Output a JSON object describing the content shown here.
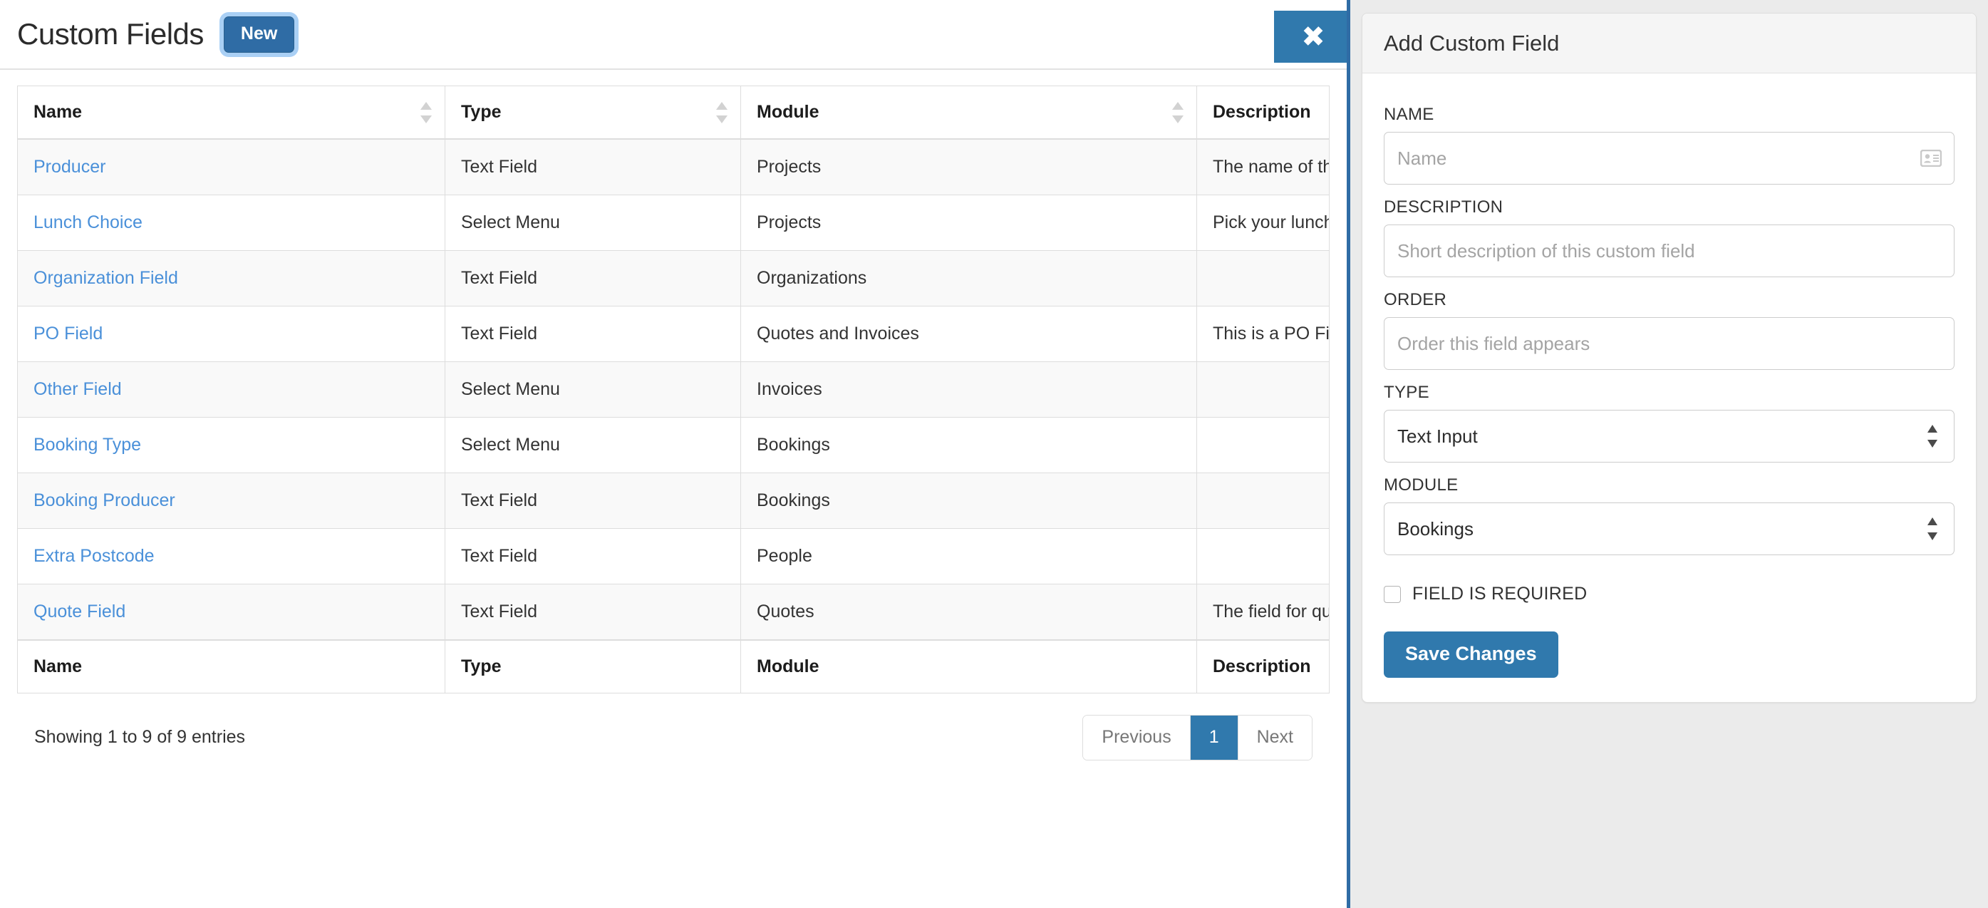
{
  "page": {
    "title": "Custom Fields",
    "new_button_label": "New",
    "close_icon": "close-icon",
    "close_label": "✖"
  },
  "table": {
    "columns": [
      {
        "label": "Name",
        "sortable": true
      },
      {
        "label": "Type",
        "sortable": true
      },
      {
        "label": "Module",
        "sortable": true
      },
      {
        "label": "Description",
        "sortable": true
      }
    ],
    "rows": [
      {
        "name": "Producer",
        "type": "Text Field",
        "module": "Projects",
        "description": "The name of the p"
      },
      {
        "name": "Lunch Choice",
        "type": "Select Menu",
        "module": "Projects",
        "description": "Pick your lunch ch"
      },
      {
        "name": "Organization Field",
        "type": "Text Field",
        "module": "Organizations",
        "description": ""
      },
      {
        "name": "PO Field",
        "type": "Text Field",
        "module": "Quotes and Invoices",
        "description": "This is a PO Field"
      },
      {
        "name": "Other Field",
        "type": "Select Menu",
        "module": "Invoices",
        "description": ""
      },
      {
        "name": "Booking Type",
        "type": "Select Menu",
        "module": "Bookings",
        "description": ""
      },
      {
        "name": "Booking Producer",
        "type": "Text Field",
        "module": "Bookings",
        "description": ""
      },
      {
        "name": "Extra Postcode",
        "type": "Text Field",
        "module": "People",
        "description": ""
      },
      {
        "name": "Quote Field",
        "type": "Text Field",
        "module": "Quotes",
        "description": "The field for quote"
      }
    ],
    "footer_columns": [
      "Name",
      "Type",
      "Module",
      "Description"
    ],
    "entries_info": "Showing 1 to 9 of 9 entries",
    "pagination": {
      "previous_label": "Previous",
      "page_label": "1",
      "next_label": "Next"
    }
  },
  "panel": {
    "title": "Add Custom Field",
    "fields": {
      "name": {
        "label": "NAME",
        "placeholder": "Name",
        "value": "",
        "icon": "address-card-icon"
      },
      "description": {
        "label": "DESCRIPTION",
        "placeholder": "Short description of this custom field",
        "value": ""
      },
      "order": {
        "label": "ORDER",
        "placeholder": "Order this field appears",
        "value": ""
      },
      "type": {
        "label": "TYPE",
        "selected": "Text Input"
      },
      "module": {
        "label": "MODULE",
        "selected": "Bookings"
      },
      "required": {
        "label": "FIELD IS REQUIRED",
        "checked": false
      }
    },
    "save_button_label": "Save Changes"
  },
  "colors": {
    "accent_blue": "#3079ad",
    "link_blue": "#4a90d9",
    "panel_bg": "#ebebeb",
    "row_stripe": "#f9f9f9",
    "border": "#dddddd"
  }
}
